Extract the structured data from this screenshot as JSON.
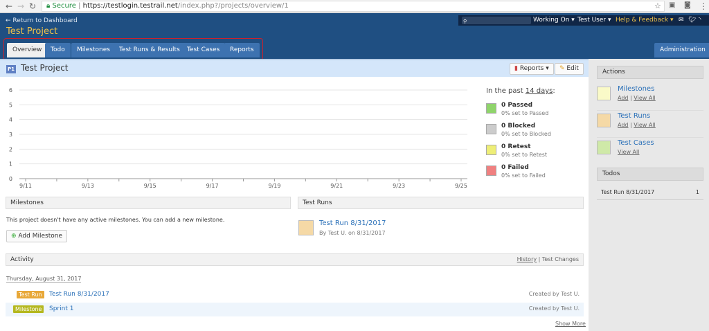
{
  "browser": {
    "secure": "Secure",
    "url_host": "https://testlogin.testrail.net",
    "url_path": "/index.php?/projects/overview/1"
  },
  "header": {
    "return": "← Return to Dashboard",
    "project_title": "Test Project",
    "working_on": "Working On ▾",
    "user": "Test User ▾",
    "help": "Help & Feedback ▾",
    "tabs": [
      "Overview",
      "Todo",
      "Milestones",
      "Test Runs & Results",
      "Test Cases",
      "Reports"
    ],
    "admin": "Administration",
    "colors": {
      "header": "#1f4f82",
      "tab": "#3d72b0",
      "help": "#f0c24a"
    }
  },
  "project": {
    "badge": "P1",
    "name": "Test Project",
    "reports_btn": "Reports ▾",
    "edit_btn": "Edit"
  },
  "chart_data": {
    "type": "line",
    "title": "",
    "x": [
      "9/11",
      "9/12",
      "9/13",
      "9/14",
      "9/15",
      "9/16",
      "9/17",
      "9/18",
      "9/19",
      "9/20",
      "9/21",
      "9/22",
      "9/23",
      "9/24",
      "9/25"
    ],
    "tick_labels": [
      "9/11",
      "9/13",
      "9/15",
      "9/17",
      "9/19",
      "9/21",
      "9/23",
      "9/25"
    ],
    "ylim": [
      0,
      6
    ],
    "yticks": [
      "0",
      "1",
      "2",
      "3",
      "4",
      "5",
      "6"
    ],
    "grid": true,
    "series": []
  },
  "legend": {
    "heading_pre": "In the past ",
    "heading_link": "14 days",
    "heading_post": ":",
    "items": [
      {
        "title": "0 Passed",
        "sub": "0% set to Passed",
        "color": "#8fd46b"
      },
      {
        "title": "0 Blocked",
        "sub": "0% set to Blocked",
        "color": "#cccccc"
      },
      {
        "title": "0 Retest",
        "sub": "0% set to Retest",
        "color": "#eeee77"
      },
      {
        "title": "0 Failed",
        "sub": "0% set to Failed",
        "color": "#f08080"
      }
    ]
  },
  "milestones": {
    "header": "Milestones",
    "text": "This project doesn't have any active milestones. You can add a new milestone.",
    "button": "Add Milestone"
  },
  "testruns": {
    "header": "Test Runs",
    "run_name": "Test Run 8/31/2017",
    "run_meta": "By Test U. on 8/31/2017"
  },
  "activity": {
    "header": "Activity",
    "history": "History",
    "sep": "|",
    "changes": "Test Changes",
    "date": "Thursday, August 31, 2017",
    "rows": [
      {
        "badge": "Test Run",
        "badge_color": "#e8a838",
        "title": "Test Run 8/31/2017",
        "by": "Created by Test U."
      },
      {
        "badge": "Milestone",
        "badge_color": "#b5b820",
        "title": "Sprint 1",
        "by": "Created by Test U."
      }
    ],
    "show_more": "Show More"
  },
  "sidebar": {
    "actions_header": "Actions",
    "items": [
      {
        "label": "Milestones",
        "add": "Add",
        "sep": "|",
        "view": "View All",
        "color": "#fafac8"
      },
      {
        "label": "Test Runs",
        "add": "Add",
        "sep": "|",
        "view": "View All",
        "color": "#f5d9a6"
      },
      {
        "label": "Test Cases",
        "view": "View All",
        "color": "#cfe9a8"
      }
    ],
    "todos_header": "Todos",
    "todos": [
      {
        "label": "Test Run 8/31/2017",
        "count": "1"
      }
    ]
  }
}
